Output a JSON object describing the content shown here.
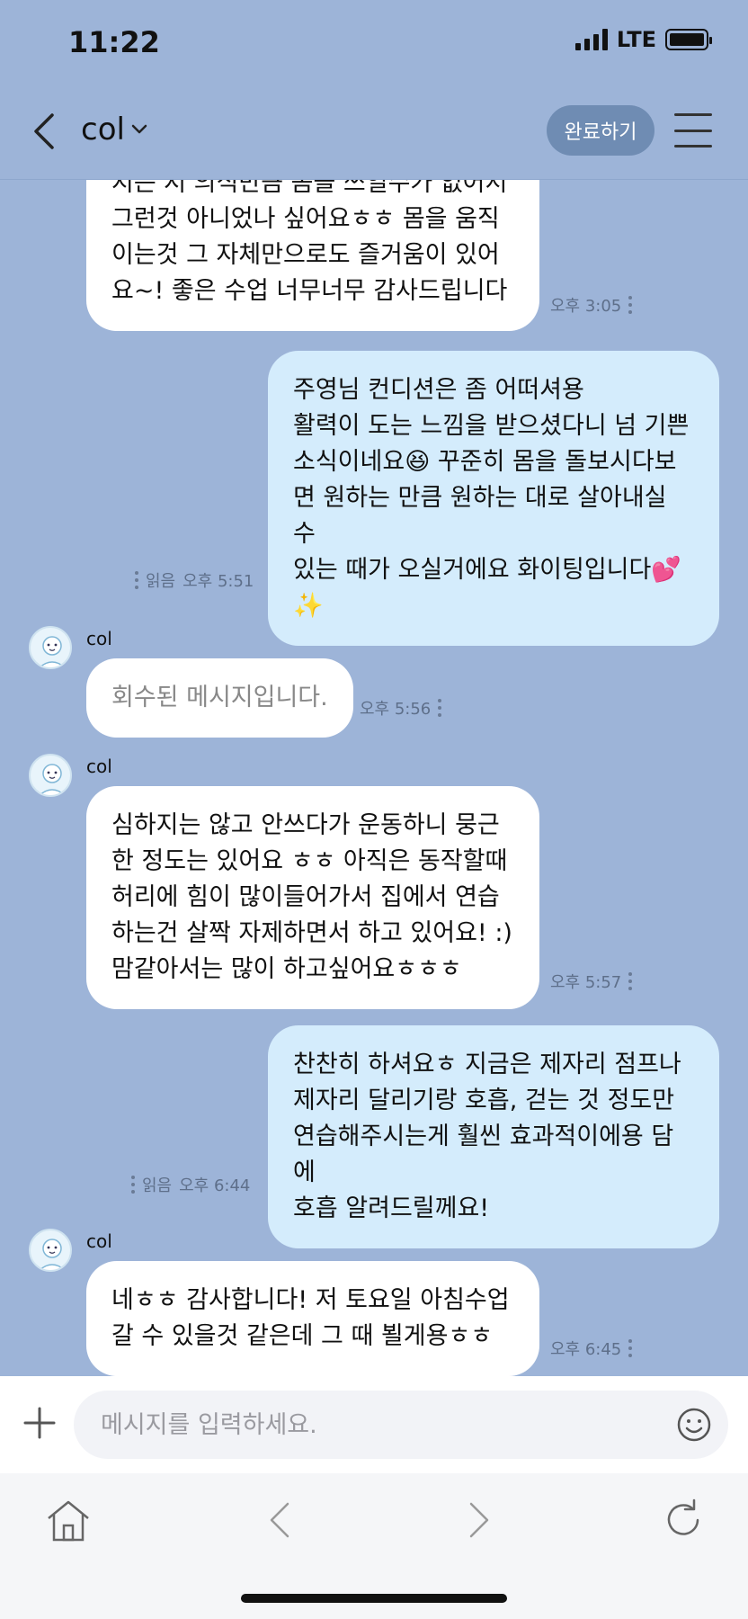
{
  "status_bar": {
    "time": "11:22",
    "network": "LTE"
  },
  "header": {
    "title": "col",
    "done_button": "완료하기"
  },
  "messages": [
    {
      "direction": "in",
      "lines": [
        "지는 저 의식만큼 몸을 쓰일수가 없어서",
        "그런것 아니었나 싶어요ㅎㅎ 몸을 움직",
        "이는것 그 자체만으로도 즐거움이 있어",
        "요~! 좋은 수업 너무너무 감사드립니다"
      ],
      "time": "오후 3:05"
    },
    {
      "direction": "out",
      "lines": [
        "주영님 컨디션은 좀 어떠셔용",
        "활력이 도는 느낌을 받으셨다니 넘 기쁜",
        "소식이네요😆 꾸준히 몸을 돌보시다보",
        "면 원하는 만큼 원하는 대로 살아내실 수",
        "있는 때가 오실거에요 화이팅입니다💕",
        "✨"
      ],
      "read": "읽음",
      "time": "오후 5:51"
    },
    {
      "direction": "in",
      "sender": "col",
      "lines": [
        "회수된 메시지입니다."
      ],
      "time": "오후 5:56"
    },
    {
      "direction": "in",
      "sender": "col",
      "lines": [
        "심하지는 않고 안쓰다가 운동하니 뭉근",
        "한 정도는 있어요 ㅎㅎ 아직은 동작할때",
        "허리에 힘이 많이들어가서 집에서 연습",
        "하는건 살짝 자제하면서 하고 있어요! :)",
        "맘같아서는 많이 하고싶어요ㅎㅎㅎ"
      ],
      "time": "오후 5:57"
    },
    {
      "direction": "out",
      "lines": [
        "찬찬히 하셔요ㅎ 지금은 제자리 점프나",
        "제자리 달리기랑 호흡, 걷는 것 정도만",
        "연습해주시는게 훨씬 효과적이에용 담에",
        "호흡 알려드릴께요!"
      ],
      "read": "읽음",
      "time": "오후 6:44"
    },
    {
      "direction": "in",
      "sender": "col",
      "lines": [
        "네ㅎㅎ 감사합니다! 저 토요일 아침수업",
        "갈 수 있을것 같은데 그 때 뵐게용ㅎㅎ"
      ],
      "time": "오후 6:45"
    }
  ],
  "input": {
    "placeholder": "메시지를 입력하세요."
  },
  "icons": {
    "back": "chevron-left-icon",
    "dropdown": "chevron-down-icon",
    "menu": "hamburger-icon",
    "plus": "plus-icon",
    "emoji": "smiley-icon",
    "home": "home-icon",
    "browser_back": "chevron-left-icon",
    "browser_forward": "chevron-right-icon",
    "refresh": "refresh-icon"
  },
  "colors": {
    "chat_bg": "#9db4d8",
    "outgoing_bubble": "#d4ecfc",
    "incoming_bubble": "#ffffff",
    "done_button": "#6f8cb3"
  }
}
